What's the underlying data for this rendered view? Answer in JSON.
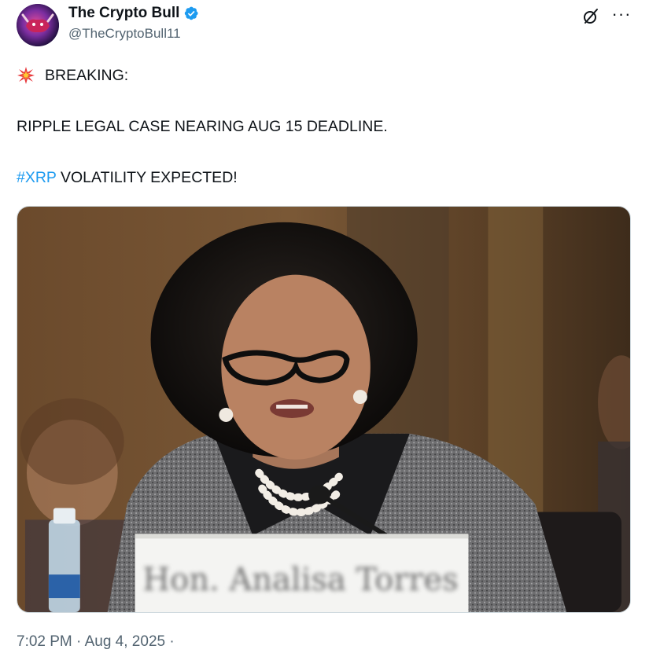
{
  "author": {
    "display_name": "The Crypto Bull",
    "handle": "@TheCryptoBull11",
    "verified": true
  },
  "icons": {
    "avatar": "bull-avatar",
    "verified": "verified-badge-icon",
    "grok": "grok-icon",
    "more": "more-options-icon",
    "collision": "collision-emoji-icon"
  },
  "post": {
    "line1": "BREAKING:",
    "line2": "RIPPLE LEGAL CASE NEARING AUG 15 DEADLINE.",
    "hashtag": "#XRP",
    "line3_rest": " VOLATILITY EXPECTED!"
  },
  "media": {
    "nameplate": "Hon. Analisa Torres"
  },
  "meta": {
    "more_glyph": "···",
    "timestamp": "7:02 PM · Aug 4, 2025 ·"
  },
  "colors": {
    "link": "#1d9bf0",
    "verified": "#1d9bf0",
    "secondary_text": "#536471"
  }
}
